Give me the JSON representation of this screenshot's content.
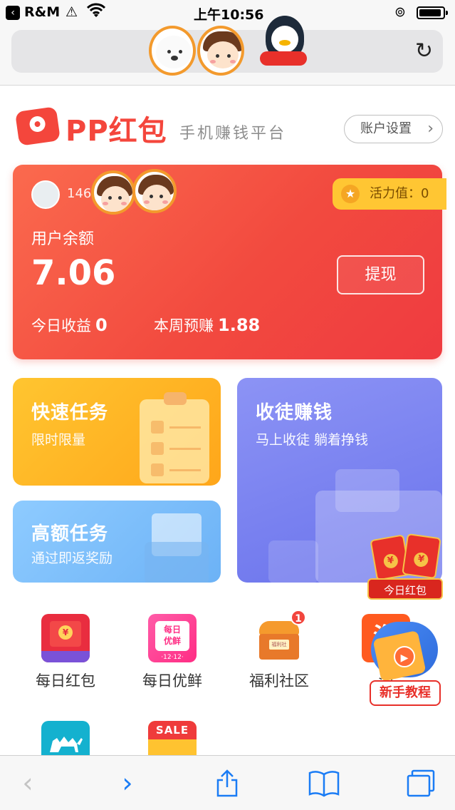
{
  "status_bar": {
    "carrier": "R&M",
    "time": "上午10:56"
  },
  "brand": {
    "name": "PP红包",
    "slogan": "手机赚钱平台",
    "account_button": "账户设置"
  },
  "balance_card": {
    "user_id": "146",
    "vitality_label": "活力值：0",
    "balance_label": "用户余额",
    "balance_value": "7.06",
    "withdraw_label": "提现",
    "today_label": "今日收益",
    "today_value": "0",
    "week_label": "本周预赚",
    "week_value": "1.88"
  },
  "tiles": {
    "fast": {
      "title": "快速任务",
      "subtitle": "限时限量"
    },
    "high": {
      "title": "高额任务",
      "subtitle": "通过即返奖励"
    },
    "recruit": {
      "title": "收徒赚钱",
      "subtitle": "马上收徒 躺着挣钱"
    }
  },
  "floats": {
    "redpacket_label": "今日红包",
    "tutorial_label": "新手教程"
  },
  "grid": {
    "items": [
      {
        "label": "每日红包"
      },
      {
        "label": "每日优鲜",
        "icon_text": "每日\n优鲜",
        "icon_date": "·12·12·"
      },
      {
        "label": "福利社区",
        "badge": "1",
        "icon_text": "福利社"
      },
      {
        "label": "淘",
        "icon_text": "淘"
      },
      {
        "label": ""
      },
      {
        "label": "",
        "icon_text": "SALE"
      }
    ]
  },
  "icons": {
    "reload": "reload-icon",
    "back": "chevron-left-icon",
    "forward": "chevron-right-icon",
    "share": "share-icon",
    "bookmarks": "book-icon",
    "tabs": "tabs-icon"
  },
  "colors": {
    "brand_red": "#f4463c",
    "accent_blue": "#1a7cf5",
    "vitality_yellow": "#ffc633"
  }
}
